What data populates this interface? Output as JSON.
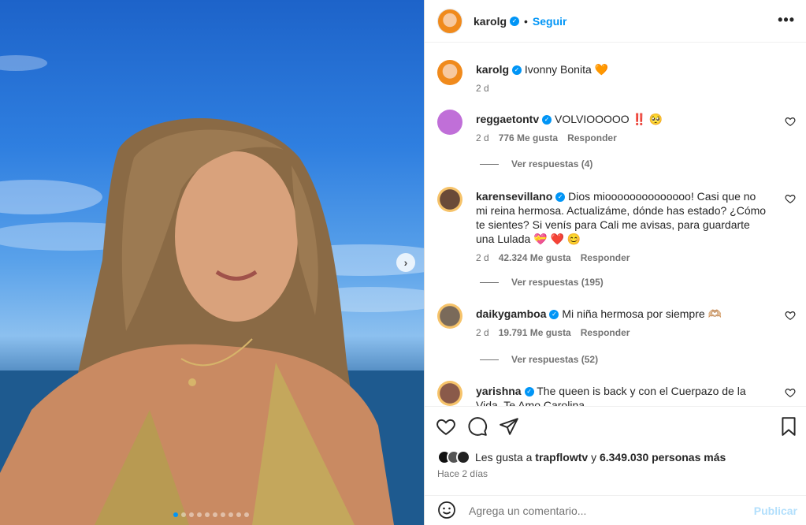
{
  "photo": {
    "next_icon": "chevron-right-icon",
    "carousel": {
      "count": 10,
      "active": 0
    }
  },
  "header": {
    "username": "karolg",
    "bullet": "•",
    "follow_label": "Seguir",
    "more_icon": "more-horizontal-icon"
  },
  "caption": {
    "username": "karolg",
    "text": "Ivonny Bonita 🧡",
    "time": "2 d"
  },
  "comments": [
    {
      "username": "reggaetontv",
      "text": "VOLVIOOOOO ‼️ 🥺",
      "time": "2 d",
      "likes": "776 Me gusta",
      "reply": "Responder",
      "view_replies": "Ver respuestas (4)"
    },
    {
      "username": "karensevillano",
      "text": "Dios mioooooooooooooo! Casi que no mi reina hermosa. Actualizáme, dónde has estado? ¿Cómo te sientes? Si venís para Cali me avisas, para guardarte una Lulada 💝 ❤️ 😊",
      "time": "2 d",
      "likes": "42.324 Me gusta",
      "reply": "Responder",
      "view_replies": "Ver respuestas (195)"
    },
    {
      "username": "daikygamboa",
      "text": "Mi niña hermosa por siempre 🫶🏼",
      "time": "2 d",
      "likes": "19.791 Me gusta",
      "reply": "Responder",
      "view_replies": "Ver respuestas (52)"
    },
    {
      "username": "yarishna",
      "text": "The queen is back y con el Cuerpazo de la Vida. Te Amo Carolina"
    }
  ],
  "actions": {
    "like_prefix": "Les gusta a ",
    "like_user": "trapflowtv",
    "like_mid": " y ",
    "like_count": "6.349.030 personas más",
    "posted": "Hace 2 días",
    "comment_placeholder": "Agrega un comentario...",
    "publish_label": "Publicar"
  },
  "colors": {
    "accent": "#0095f6",
    "publish_disabled": "#b2dffc",
    "muted": "#737373"
  }
}
